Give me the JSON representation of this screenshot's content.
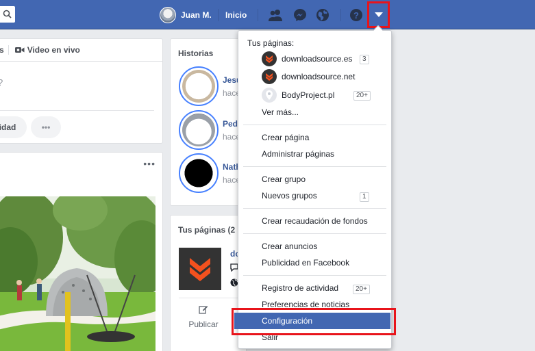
{
  "topbar": {
    "profile_name": "Juan M.",
    "home_label": "Inicio",
    "icons": [
      "search-icon",
      "friends-icon",
      "messenger-icon",
      "notifications-globe-icon",
      "help-icon",
      "account-dropdown-icon"
    ]
  },
  "composer": {
    "tab_stub": "s",
    "live_tab": "Video en vivo",
    "question_stub": "?",
    "pill_stub": "idad",
    "more_pill": "•••"
  },
  "post": {
    "more": "•••"
  },
  "stories": {
    "title": "Historias",
    "items": [
      {
        "name": "Jesu",
        "sub": "hace"
      },
      {
        "name": "Pedr",
        "sub": "hace"
      },
      {
        "name": "Nath",
        "sub": "hace"
      }
    ]
  },
  "pages_card": {
    "title": "Tus páginas (2",
    "page_stub": "do",
    "publish": "Publicar"
  },
  "menu": {
    "header": "Tus páginas:",
    "pages": [
      {
        "label": "downloadsource.es",
        "badge": "3"
      },
      {
        "label": "downloadsource.net",
        "badge": ""
      },
      {
        "label": "BodyProject.pl",
        "badge": "20+"
      }
    ],
    "see_more": "Ver más...",
    "create_page": "Crear página",
    "manage_pages": "Administrar páginas",
    "create_group": "Crear grupo",
    "new_groups": "Nuevos grupos",
    "new_groups_badge": "1",
    "fundraiser": "Crear recaudación de fondos",
    "create_ads": "Crear anuncios",
    "advertise": "Publicidad en Facebook",
    "activity_log": "Registro de actividad",
    "activity_badge": "20+",
    "news_prefs": "Preferencias de noticias",
    "settings": "Configuración",
    "logout": "Salir"
  },
  "colors": {
    "brand_blue": "#4267b2",
    "highlight_red": "#e8141b",
    "page_orange": "#f4511e"
  }
}
